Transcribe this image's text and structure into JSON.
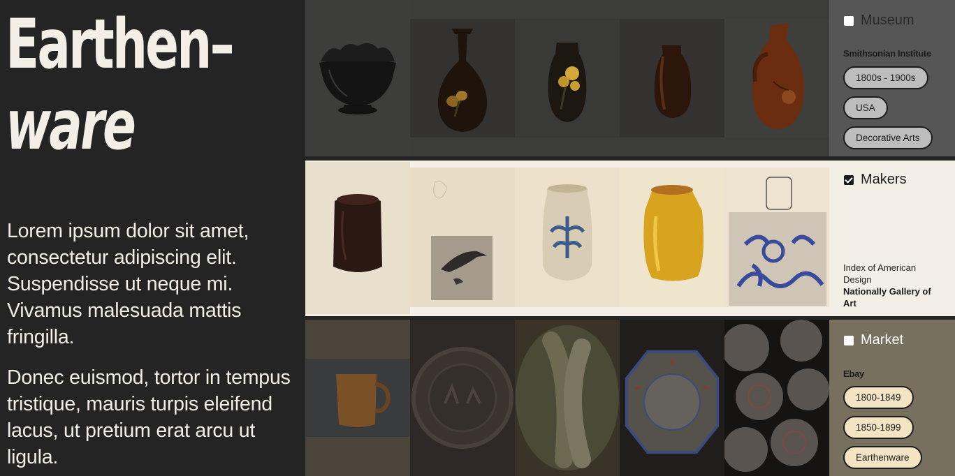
{
  "hero": {
    "title_line1": "Earthen–",
    "title_line2": "ware",
    "paragraph1": "Lorem ipsum dolor sit amet, consectetur adipiscing elit. Suspendisse ut neque mi. Vivamus malesuada mattis fringilla.",
    "paragraph2": "Donec euismod, tortor in tempus tristique, mauris turpis eleifend lacus, ut pretium erat arcu ut ligula."
  },
  "rows": [
    {
      "filter_label": "Museum",
      "checked": false,
      "source": "Smithsonian Institute",
      "chips": [
        "1800s - 1900s",
        "USA",
        "Decorative Arts"
      ]
    },
    {
      "filter_label": "Makers",
      "checked": true,
      "source_line": "Index of American Design",
      "source_bold": "Nationally Gallery of Art"
    },
    {
      "filter_label": "Market",
      "checked": false,
      "source": "Ebay",
      "chips": [
        "1800-1849",
        "1850-1899",
        "Earthenware"
      ]
    }
  ],
  "colors": {
    "background": "#242424",
    "cream": "#f3efe6",
    "museum_panel": "#575656",
    "market_panel": "#77705f",
    "market_chip": "#f3e4c4"
  }
}
